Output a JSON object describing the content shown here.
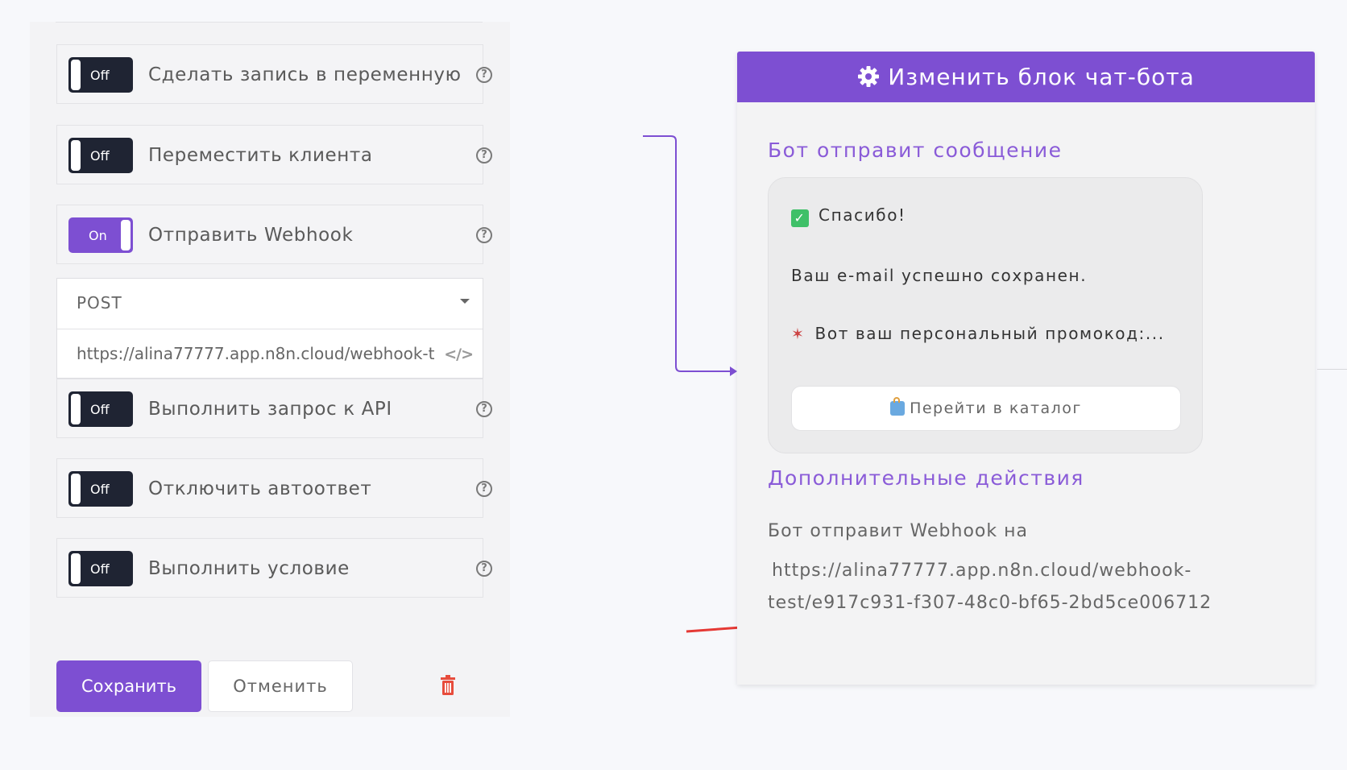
{
  "left_panel": {
    "actions": [
      {
        "label": "Сделать запись в переменную",
        "state": "Off",
        "help": "?"
      },
      {
        "label": "Переместить клиента",
        "state": "Off",
        "help": "?"
      },
      {
        "label": "Отправить Webhook",
        "state": "On",
        "help": "?"
      },
      {
        "label": "Выполнить запрос к API",
        "state": "Off",
        "help": "?"
      },
      {
        "label": "Отключить автоответ",
        "state": "Off",
        "help": "?"
      },
      {
        "label": "Выполнить условие",
        "state": "Off",
        "help": "?"
      }
    ],
    "webhook": {
      "method": "POST",
      "url": "https://alina77777.app.n8n.cloud/webhook-test/e917c931-f307-48c0-bf65-2bd5ce006712",
      "code_icon": "</>"
    },
    "save_label": "Сохранить",
    "cancel_label": "Отменить"
  },
  "card": {
    "title": "Изменить блок чат-бота",
    "message_section_title": "Бот отправит сообщение",
    "message": {
      "line1": "Спасибо!",
      "line2": "Ваш e-mail успешно сохранен.",
      "line3": "Вот ваш персональный промокод:...",
      "button_label": "Перейти в каталог"
    },
    "additional_section_title": "Дополнительные действия",
    "webhook_info_label": "Бот отправит Webhook на",
    "webhook_url_line1": "https://alina77777.app.n8n.cloud/webhook-",
    "webhook_url_line2": "test/e917c931-f307-48c0-bf65-2bd5ce006712"
  },
  "colors": {
    "accent": "#7d4fd2",
    "toggle_off": "#1f2433",
    "check": "#3fc068",
    "annotation_arrow": "#e53935",
    "trash": "#e74c3c"
  },
  "icons": [
    "gear-icon",
    "help-icon",
    "code-icon",
    "trash-icon",
    "check-icon",
    "party-icon",
    "shopping-bag-icon",
    "chevron-down-icon"
  ]
}
